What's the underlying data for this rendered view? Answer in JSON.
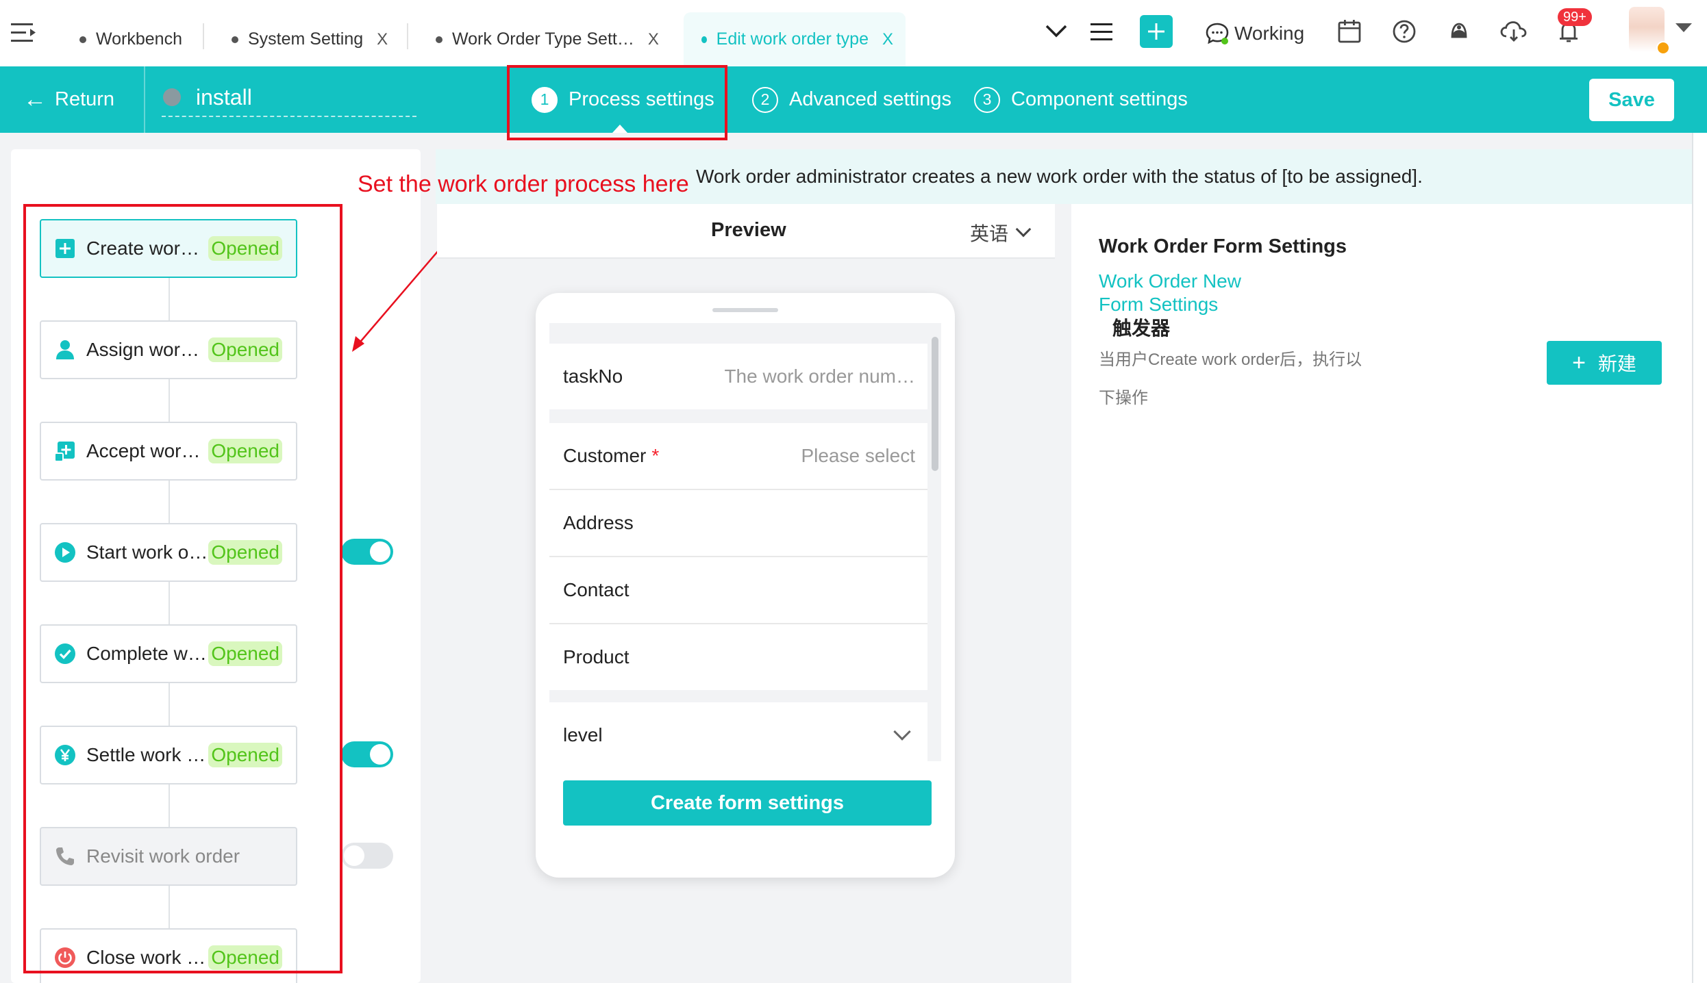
{
  "tabs": [
    {
      "label": "Workbench",
      "closable": false,
      "active": false
    },
    {
      "label": "System Setting",
      "closable": true,
      "active": false
    },
    {
      "label": "Work Order Type Sett…",
      "closable": true,
      "active": false
    },
    {
      "label": "Edit work order type",
      "closable": true,
      "active": true
    }
  ],
  "tab_close_glyph": "X",
  "toolbar": {
    "working_label": "Working",
    "notification_badge": "99+"
  },
  "header": {
    "return_label": "Return",
    "type_name": "install",
    "steps": [
      {
        "num": "1",
        "label": "Process settings"
      },
      {
        "num": "2",
        "label": "Advanced settings"
      },
      {
        "num": "3",
        "label": "Component settings"
      }
    ],
    "save_label": "Save"
  },
  "annotation": {
    "text": "Set the work order process here"
  },
  "process_nodes": [
    {
      "label": "Create work…",
      "status": "Opened",
      "icon": "plus-square-icon",
      "selected": true,
      "enabled": true,
      "toggle": null
    },
    {
      "label": "Assign wor…",
      "status": "Opened",
      "icon": "user-assign-icon",
      "selected": false,
      "enabled": true,
      "toggle": null
    },
    {
      "label": "Accept wor…",
      "status": "Opened",
      "icon": "accept-icon",
      "selected": false,
      "enabled": true,
      "toggle": null
    },
    {
      "label": "Start work o…",
      "status": "Opened",
      "icon": "play-icon",
      "selected": false,
      "enabled": true,
      "toggle": "on"
    },
    {
      "label": "Complete w…",
      "status": "Opened",
      "icon": "check-circle-icon",
      "selected": false,
      "enabled": true,
      "toggle": null
    },
    {
      "label": "Settle work …",
      "status": "Opened",
      "icon": "yen-icon",
      "selected": false,
      "enabled": true,
      "toggle": "on"
    },
    {
      "label": "Revisit work order",
      "status": "",
      "icon": "phone-icon",
      "selected": false,
      "enabled": false,
      "toggle": "off"
    },
    {
      "label": "Close work …",
      "status": "Opened",
      "icon": "power-icon",
      "selected": false,
      "enabled": true,
      "toggle": null
    }
  ],
  "banner": {
    "text": "Work order administrator creates a new work order with the status of [to be assigned]."
  },
  "preview": {
    "title": "Preview",
    "language": "英语",
    "fields": [
      {
        "label": "taskNo",
        "placeholder": "The work order num…",
        "required": false
      },
      {
        "label": "Customer",
        "placeholder": "Please select",
        "required": true
      },
      {
        "label": "Address",
        "placeholder": "",
        "required": false
      },
      {
        "label": "Contact",
        "placeholder": "",
        "required": false
      },
      {
        "label": "Product",
        "placeholder": "",
        "required": false
      },
      {
        "label": "level",
        "placeholder": "",
        "required": false
      }
    ],
    "required_mark": "*",
    "create_button_label": "Create form settings"
  },
  "settings": {
    "title": "Work Order Form Settings",
    "link_label": "Work Order New Form Settings",
    "trigger_label": "触发器",
    "description": "当用户Create work order后，执行以下操作",
    "new_button_label": "新建",
    "new_button_glyph": "+"
  },
  "colors": {
    "accent": "#13c2c2",
    "annotation_red": "#e8101f",
    "status_green": "#52c41a",
    "status_green_bg": "#d9f7be",
    "badge_red": "#f0323c"
  }
}
